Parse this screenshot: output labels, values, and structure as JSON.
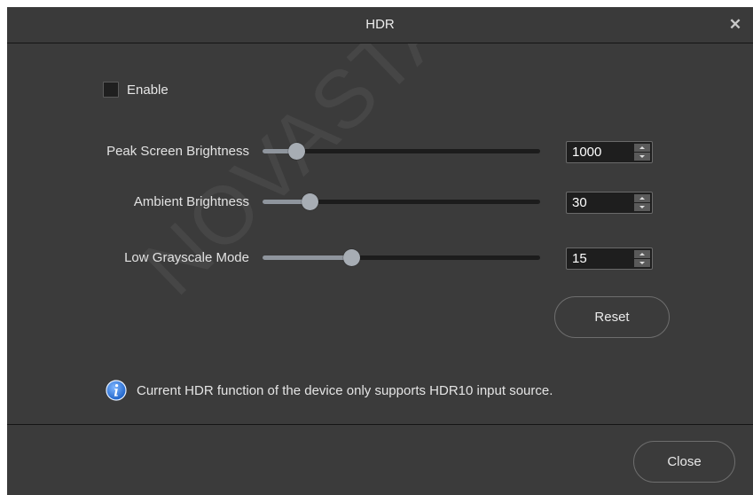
{
  "dialog": {
    "title": "HDR",
    "close_icon": "close-icon",
    "enable": {
      "label": "Enable",
      "checked": false
    },
    "sliders": [
      {
        "label": "Peak Screen Brightness",
        "value": "1000",
        "fill_fraction": 0.12
      },
      {
        "label": "Ambient Brightness",
        "value": "30",
        "fill_fraction": 0.17
      },
      {
        "label": "Low Grayscale Mode",
        "value": "15",
        "fill_fraction": 0.32
      }
    ],
    "reset_label": "Reset",
    "info": {
      "icon": "info-icon",
      "text": "Current HDR function of the device only supports HDR10 input source."
    },
    "close_label": "Close",
    "watermark": "NOVASTAR TECH"
  },
  "colors": {
    "background": "#3b3b3b",
    "slider_fill": "#8f959d",
    "track": "#1c1c1c",
    "info_blue": "#2f7be0"
  }
}
